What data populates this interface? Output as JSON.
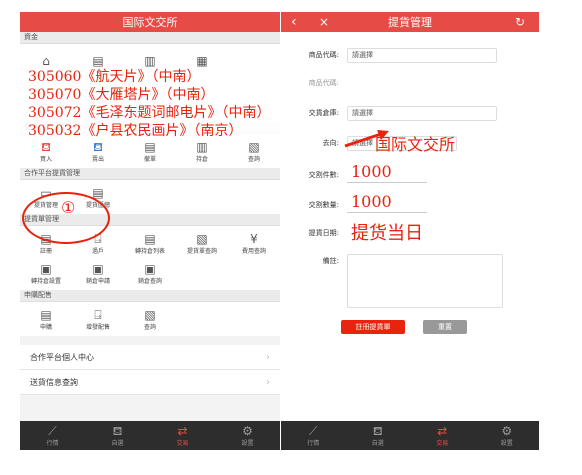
{
  "left": {
    "title": "国际文交所",
    "sections": {
      "funds": "資金",
      "trade": "交易",
      "platform": "合作平台提貨管理",
      "delivery": "提貨單管理",
      "subscribe": "申購配售"
    },
    "trade_items": [
      "買入",
      "賣出",
      "撤單",
      "持倉",
      "查詢"
    ],
    "platform_items": [
      "提貨管理",
      "提貨匯總"
    ],
    "delivery_items": [
      "註冊",
      "過戶",
      "轉持倉列表",
      "提貨單查詢",
      "費用查詢",
      "轉持倉設置",
      "銷倉申請",
      "銷倉查詢"
    ],
    "subscribe_items": [
      "申購",
      "增發配售",
      "查詢"
    ],
    "links": [
      "合作平台個人中心",
      "送貨信息查詢"
    ],
    "overlay_lines": [
      "305060《航天片》（中南）",
      "305070《大雁塔片》（中南）",
      "305072《毛泽东题词邮电片》（中南）",
      "305032《户县农民画片》（南京）"
    ],
    "circle_number": "①"
  },
  "right": {
    "title": "提貨管理",
    "back_icon": "‹",
    "close_icon": "×",
    "refresh_icon": "↻",
    "fields": {
      "product_code": {
        "label": "商品代碼:",
        "value": "請選擇"
      },
      "product_name": {
        "label": "商品代碼:",
        "value": ""
      },
      "warehouse": {
        "label": "交貨倉庫:",
        "value": "請選擇"
      },
      "destination": {
        "label": "去向:",
        "value": "請選擇"
      },
      "quantity_pieces": {
        "label": "交割件數:",
        "value": "1000"
      },
      "quantity": {
        "label": "交割數量:",
        "value": "1000"
      },
      "date": {
        "label": "提貨日期:",
        "value": "提货当日"
      },
      "remark": {
        "label": "備註:",
        "value": ""
      }
    },
    "destination_annotation": "国际文交所",
    "buttons": {
      "register": "註冊提貨單",
      "reset": "重置"
    }
  },
  "tabbar": {
    "items": [
      "行情",
      "自選",
      "交易",
      "設置"
    ],
    "active": "交易"
  },
  "colors": {
    "brand_red": "#e64c45",
    "annotation_red": "#e8230e",
    "tabbar_bg": "#2d2d2d"
  }
}
